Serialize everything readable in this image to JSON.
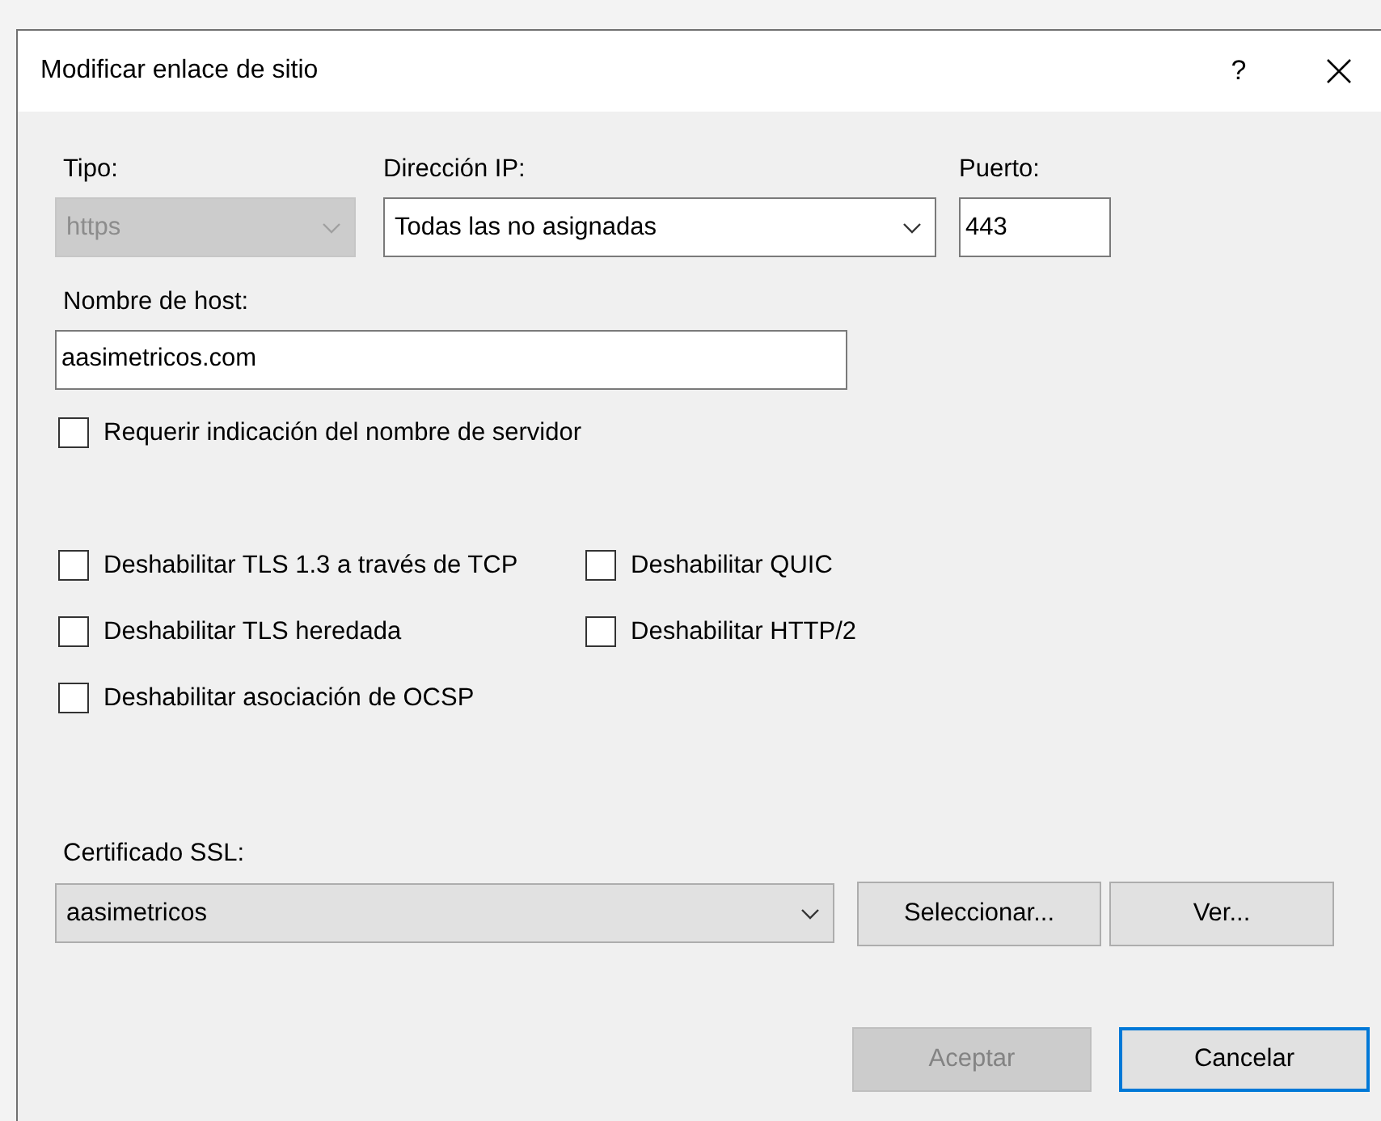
{
  "window": {
    "title": "Modificar enlace de sitio",
    "help": "?"
  },
  "type": {
    "label": "Tipo:",
    "value": "https",
    "disabled": true
  },
  "ip": {
    "label": "Dirección IP:",
    "value": "Todas las no asignadas",
    "disabled": false
  },
  "port": {
    "label": "Puerto:",
    "value": "443"
  },
  "host": {
    "label": "Nombre de host:",
    "value": "aasimetricos.com"
  },
  "sni": {
    "label": "Requerir indicación del nombre de servidor",
    "checked": false
  },
  "options": [
    {
      "label": "Deshabilitar TLS 1.3 a través de TCP",
      "checked": false
    },
    {
      "label": "Deshabilitar QUIC",
      "checked": false
    },
    {
      "label": "Deshabilitar TLS heredada",
      "checked": false
    },
    {
      "label": "Deshabilitar HTTP/2",
      "checked": false
    },
    {
      "label": "Deshabilitar asociación de OCSP",
      "checked": false
    }
  ],
  "certificate": {
    "label": "Certificado SSL:",
    "value": "aasimetricos",
    "disabled": false,
    "buttons": [
      "Seleccionar...",
      "Ver..."
    ]
  },
  "buttons": [
    {
      "label": "Aceptar",
      "disabled": true,
      "default": false
    },
    {
      "label": "Cancelar",
      "disabled": false,
      "default": true
    }
  ]
}
